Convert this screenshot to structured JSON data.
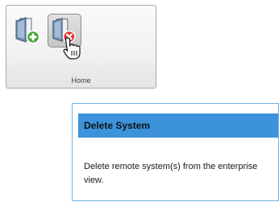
{
  "ribbon": {
    "group_label": "Home",
    "buttons": [
      {
        "name": "add-system",
        "icon": "add-system-icon"
      },
      {
        "name": "delete-system",
        "icon": "delete-system-icon"
      }
    ]
  },
  "tooltip": {
    "title": "Delete System",
    "description": "Delete remote system(s) from the enterprise view."
  },
  "colors": {
    "tooltip_header": "#3c93dc",
    "tooltip_border": "#6db3e8",
    "add_badge": "#3fa535",
    "delete_badge": "#e0362c"
  }
}
